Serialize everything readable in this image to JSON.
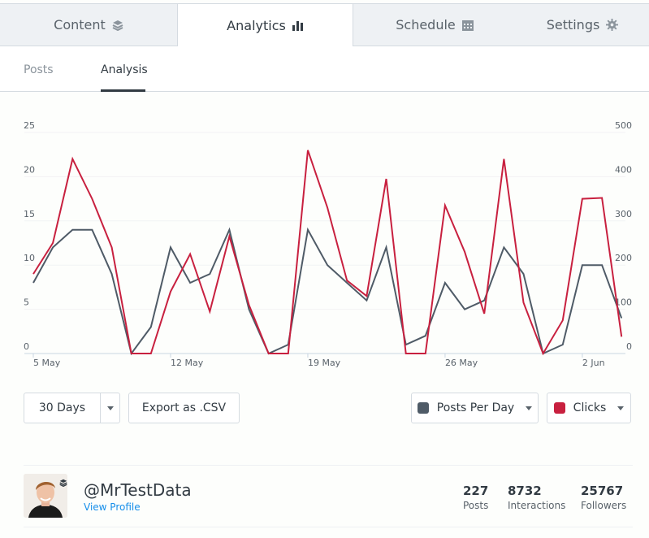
{
  "tabs": [
    {
      "label": "Content",
      "icon": "layers-icon",
      "active": false
    },
    {
      "label": "Analytics",
      "icon": "bar-chart-icon",
      "active": true
    },
    {
      "label": "Schedule",
      "icon": "calendar-icon",
      "active": false
    },
    {
      "label": "Settings",
      "icon": "gear-icon",
      "active": false
    }
  ],
  "subtabs": [
    {
      "label": "Posts",
      "active": false
    },
    {
      "label": "Analysis",
      "active": true
    }
  ],
  "colors": {
    "posts": "#4f5b67",
    "clicks": "#c8203f",
    "grid": "#f2f3f4",
    "axis": "#c9d6e2"
  },
  "chart_data": {
    "type": "line",
    "title": "",
    "x": [
      "5 May",
      "6 May",
      "7 May",
      "8 May",
      "9 May",
      "10 May",
      "11 May",
      "12 May",
      "13 May",
      "14 May",
      "15 May",
      "16 May",
      "17 May",
      "18 May",
      "19 May",
      "20 May",
      "21 May",
      "22 May",
      "23 May",
      "24 May",
      "25 May",
      "26 May",
      "27 May",
      "28 May",
      "29 May",
      "30 May",
      "31 May",
      "1 Jun",
      "2 Jun",
      "3 Jun",
      "4 Jun"
    ],
    "x_ticks": [
      "5 May",
      "12 May",
      "19 May",
      "26 May",
      "2 Jun"
    ],
    "y_left": {
      "ticks": [
        "0",
        "5",
        "10",
        "15",
        "20",
        "25"
      ],
      "range": [
        0,
        25
      ]
    },
    "y_right": {
      "ticks": [
        "0",
        "100",
        "200",
        "300",
        "400",
        "500"
      ],
      "range": [
        0,
        500
      ]
    },
    "grid": true,
    "series": [
      {
        "name": "Posts Per Day",
        "axis": "left",
        "values": [
          8,
          12,
          14,
          14,
          9,
          0,
          3,
          12,
          8,
          9,
          14,
          5,
          0,
          1,
          14,
          10,
          8,
          6,
          12,
          1,
          2,
          8,
          5,
          6,
          12,
          9,
          0,
          1,
          10,
          10,
          4
        ]
      },
      {
        "name": "Clicks",
        "axis": "right",
        "values": [
          180,
          250,
          440,
          350,
          240,
          0,
          0,
          140,
          225,
          95,
          265,
          110,
          0,
          0,
          460,
          330,
          165,
          130,
          395,
          0,
          0,
          335,
          230,
          90,
          440,
          115,
          0,
          75,
          350,
          352,
          38
        ]
      }
    ]
  },
  "controls": {
    "range_label": "30 Days",
    "export_label": "Export as .CSV",
    "metric1_label": "Posts Per Day",
    "metric2_label": "Clicks"
  },
  "profile": {
    "handle": "@MrTestData",
    "link": "View Profile",
    "stats": [
      {
        "value": "227",
        "label": "Posts"
      },
      {
        "value": "8732",
        "label": "Interactions"
      },
      {
        "value": "25767",
        "label": "Followers"
      }
    ]
  }
}
